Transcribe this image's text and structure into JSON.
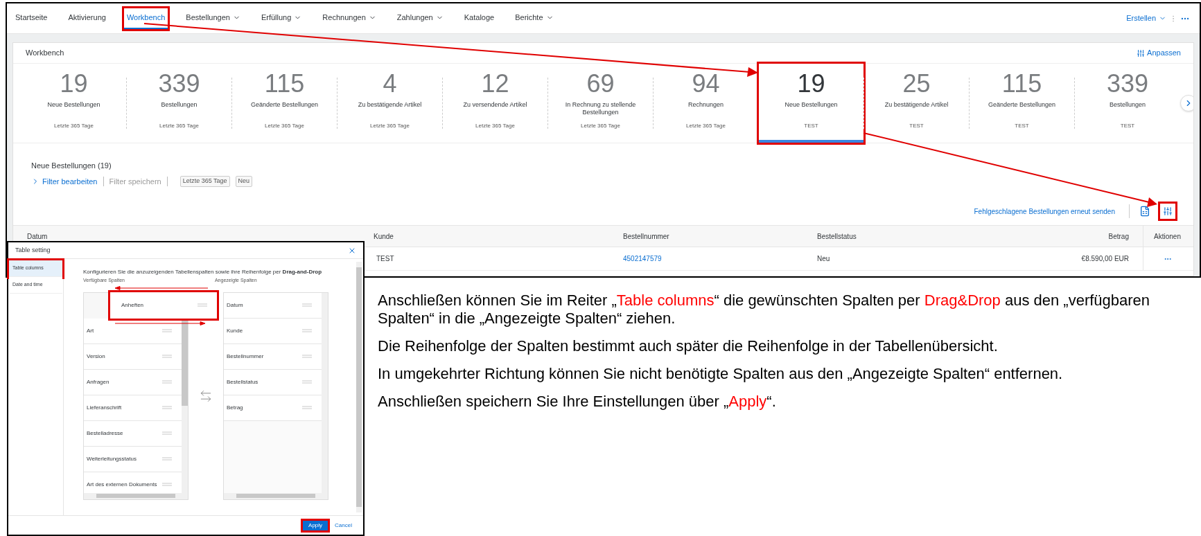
{
  "nav": {
    "items": [
      {
        "label": "Startseite",
        "dropdown": false,
        "selected": false,
        "highlighted": false
      },
      {
        "label": "Aktivierung",
        "dropdown": false,
        "selected": false,
        "highlighted": false
      },
      {
        "label": "Workbench",
        "dropdown": false,
        "selected": true,
        "highlighted": true
      },
      {
        "label": "Bestellungen",
        "dropdown": true,
        "selected": false,
        "highlighted": false
      },
      {
        "label": "Erfüllung",
        "dropdown": true,
        "selected": false,
        "highlighted": false
      },
      {
        "label": "Rechnungen",
        "dropdown": true,
        "selected": false,
        "highlighted": false
      },
      {
        "label": "Zahlungen",
        "dropdown": true,
        "selected": false,
        "highlighted": false
      },
      {
        "label": "Kataloge",
        "dropdown": false,
        "selected": false,
        "highlighted": false
      },
      {
        "label": "Berichte",
        "dropdown": true,
        "selected": false,
        "highlighted": false
      }
    ],
    "create": "Erstellen"
  },
  "workbench": {
    "title": "Workbench",
    "customize": "Anpassen",
    "tiles": [
      {
        "count": "19",
        "label": "Neue Bestellungen",
        "period": "Letzte 365 Tage",
        "selected": false,
        "highlighted": false
      },
      {
        "count": "339",
        "label": "Bestellungen",
        "period": "Letzte 365 Tage",
        "selected": false,
        "highlighted": false
      },
      {
        "count": "115",
        "label": "Geänderte Bestellungen",
        "period": "Letzte 365 Tage",
        "selected": false,
        "highlighted": false
      },
      {
        "count": "4",
        "label": "Zu bestätigende Artikel",
        "period": "Letzte 365 Tage",
        "selected": false,
        "highlighted": false
      },
      {
        "count": "12",
        "label": "Zu versendende Artikel",
        "period": "Letzte 365 Tage",
        "selected": false,
        "highlighted": false
      },
      {
        "count": "69",
        "label": "In Rechnung zu stellende Bestellungen",
        "period": "Letzte 365 Tage",
        "selected": false,
        "highlighted": false
      },
      {
        "count": "94",
        "label": "Rechnungen",
        "period": "Letzte 365 Tage",
        "selected": false,
        "highlighted": false
      },
      {
        "count": "19",
        "label": "Neue Bestellungen",
        "period": "TEST",
        "selected": true,
        "highlighted": true
      },
      {
        "count": "25",
        "label": "Zu bestätigende Artikel",
        "period": "TEST",
        "selected": false,
        "highlighted": false
      },
      {
        "count": "115",
        "label": "Geänderte Bestellungen",
        "period": "TEST",
        "selected": false,
        "highlighted": false
      },
      {
        "count": "339",
        "label": "Bestellungen",
        "period": "TEST",
        "selected": false,
        "highlighted": false
      }
    ]
  },
  "list": {
    "title": "Neue Bestellungen (19)",
    "filter_edit": "Filter bearbeiten",
    "filter_save": "Filter speichern",
    "chips": [
      "Letzte 365 Tage",
      "Neu"
    ],
    "resend": "Fehlgeschlagene Bestellungen erneut senden",
    "settings_highlighted": true
  },
  "table": {
    "columns": [
      "Datum",
      "Kunde",
      "Bestellnummer",
      "Bestellstatus",
      "Betrag",
      "Aktionen"
    ],
    "rows": [
      {
        "cells": [
          "",
          "TEST",
          "4502147579",
          "Neu",
          "€8.590,00 EUR"
        ]
      }
    ]
  },
  "dialog": {
    "title": "Table setting",
    "tabs": [
      {
        "label": "Table columns",
        "selected": true,
        "highlighted": true
      },
      {
        "label": "Date and time",
        "selected": false,
        "highlighted": false
      }
    ],
    "instruction": "Konfigurieren Sie die anzuzeigenden Tabellenspalten sowie ihre Reihenfolge per **Drag-and-Drop**",
    "available_label": "Verfügbare Spalten",
    "displayed_label": "Angezeigte Spalten",
    "dragging": {
      "label": "Anheften",
      "highlighted": true
    },
    "available": [
      "Art",
      "Version",
      "Anfragen",
      "Lieferanschrift",
      "Bestelladresse",
      "Weiterleitungsstatus",
      "Art des externen Dokuments"
    ],
    "displayed": [
      "Datum",
      "Kunde",
      "Bestellnummer",
      "Bestellstatus",
      "Betrag"
    ],
    "apply": {
      "label": "Apply",
      "highlighted": true
    },
    "cancel": "Cancel"
  },
  "notes": [
    {
      "segments": [
        {
          "text": "Anschließen können Sie im Reiter „",
          "highlight": false
        },
        {
          "text": "Table columns",
          "highlight": true
        },
        {
          "text": "“ die gewünschten Spalten per ",
          "highlight": false
        },
        {
          "text": "Drag&Drop",
          "highlight": true
        },
        {
          "text": " aus den „verfügbaren Spalten“ in die „Angezeigte Spalten“ ziehen.",
          "highlight": false
        }
      ]
    },
    {
      "segments": [
        {
          "text": "Die Reihenfolge der Spalten bestimmt auch später die Reihenfolge in der Tabellenübersicht.",
          "highlight": false
        }
      ]
    },
    {
      "segments": [
        {
          "text": "In umgekehrter Richtung können Sie nicht benötigte Spalten aus den „Angezeigte Spalten“ entfernen.",
          "highlight": false
        }
      ]
    },
    {
      "segments": [
        {
          "text": "Anschließen speichern Sie Ihre Einstellungen über „",
          "highlight": false
        },
        {
          "text": "Apply",
          "highlight": true
        },
        {
          "text": "“.",
          "highlight": false
        }
      ]
    }
  ]
}
